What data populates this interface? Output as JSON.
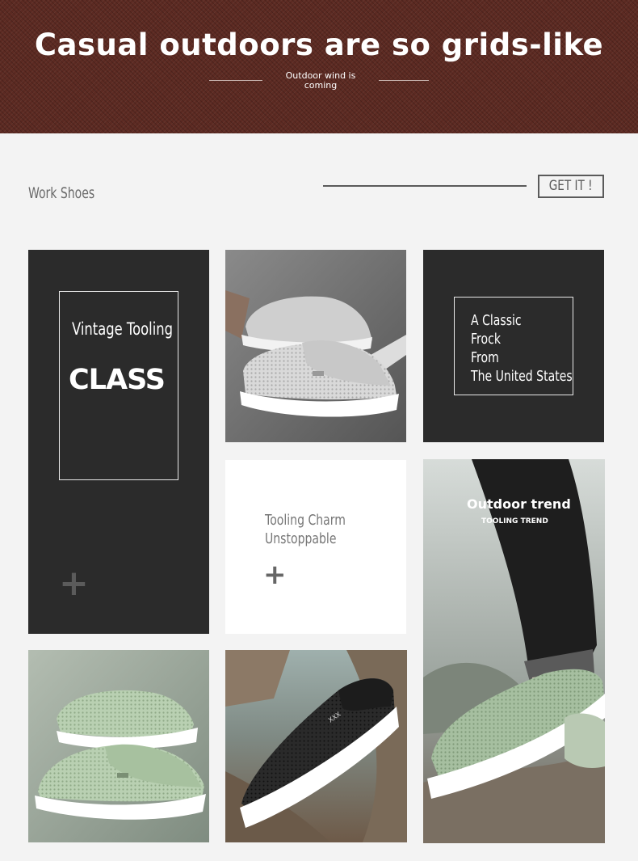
{
  "banner": {
    "title": "Casual outdoors are so grids-like",
    "subtitle": "Outdoor wind is coming",
    "color": "#5c2a22"
  },
  "section": {
    "title": "Work Shoes",
    "button_label": "GET IT !"
  },
  "tiles": {
    "vintage": {
      "line1": "Vintage Tooling",
      "line2": "CLASS",
      "plus": "+"
    },
    "classic": {
      "lines": [
        "A Classic",
        "Frock",
        "From",
        "The United States"
      ]
    },
    "charm": {
      "line1": "Tooling Charm",
      "line2": "Unstoppable",
      "plus": "+"
    },
    "outdoor_trend": {
      "title": "Outdoor trend",
      "subtitle": "TOOLING TREND"
    }
  },
  "images": {
    "grey_shoes": "grey-mesh-slip-on-shoes-photo",
    "green_shoes": "green-mesh-slip-on-shoes-photo",
    "black_shoe": "black-mesh-shoe-on-rock-photo",
    "worn_shoe": "model-wearing-green-shoe-photo"
  }
}
